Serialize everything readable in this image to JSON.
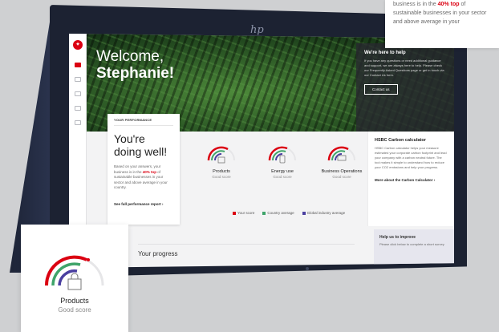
{
  "device": {
    "logo": "hp"
  },
  "hero": {
    "welcome": "Welcome,",
    "name": "Stephanie!",
    "help": {
      "title": "We're here to help",
      "text": "If you have any questions or need additional guidance and support, we are always here to help. Please check our Frequently Asked Questions page or get in touch via our Contact Us form.",
      "button": "Contact us"
    }
  },
  "performance": {
    "tag": "YOUR PERFORMANCE",
    "heading": "You're doing well!",
    "text_before": "Based on your answers, your business is in the ",
    "text_highlight": "40% top",
    "text_after": " of sustainable businesses in your sector and above average in your country.",
    "link": "See full performance report ›"
  },
  "scores": [
    {
      "name": "Products",
      "status": "Good score",
      "icon": "shopping-bag-icon"
    },
    {
      "name": "Energy use",
      "status": "Good score",
      "icon": "plug-icon"
    },
    {
      "name": "Business Operations",
      "status": "Good score",
      "icon": "presentation-board-icon"
    }
  ],
  "legend": [
    {
      "label": "Your score",
      "color": "#db0011"
    },
    {
      "label": "Country average",
      "color": "#3fa46a"
    },
    {
      "label": "Global industry average",
      "color": "#4a3fa0"
    }
  ],
  "carbon": {
    "title": "HSBC Carbon calculator",
    "text": "HSBC Carbon calculator helps your measure estimated your corporate carbon footprint and lead your company with a carbon neutral future. The tool makes it simple to understand how to reduce your CO2 emissions and help your progress.",
    "link": "More about the Carbon Calculator ›"
  },
  "improve": {
    "title": "Help us to improve",
    "text": "Please click below to complete a short survey"
  },
  "progress": {
    "title": "Your progress"
  },
  "note": {
    "text_before": "business is in the ",
    "text_highlight": "40% top",
    "text_after": " of sustainable businesses in your sector and above average in your"
  },
  "float_card": {
    "name": "Products",
    "status": "Good score"
  },
  "colors": {
    "brand": "#db0011",
    "green": "#3fa46a",
    "purple": "#4a3fa0",
    "track": "#e6e6e8"
  }
}
